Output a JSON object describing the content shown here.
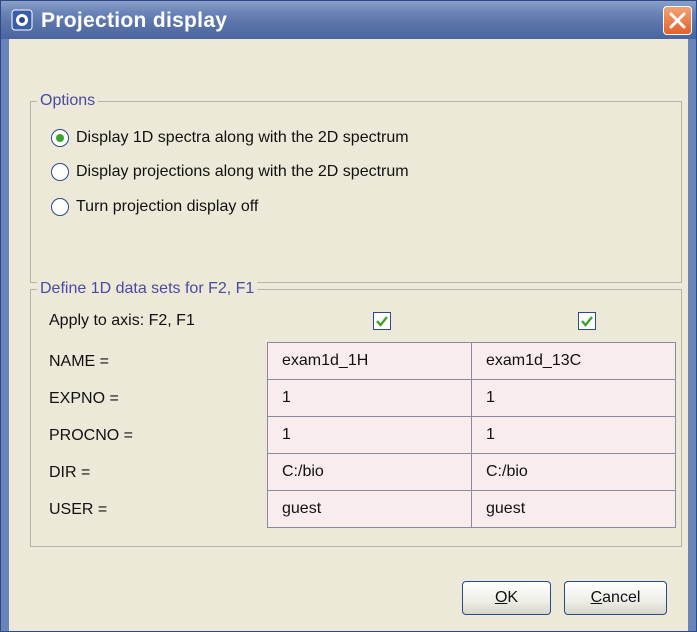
{
  "window": {
    "title": "Projection display",
    "close_icon": "close-icon"
  },
  "options": {
    "legend": "Options",
    "radios": [
      {
        "label": "Display 1D spectra along with the 2D spectrum",
        "checked": true
      },
      {
        "label": "Display projections along with the 2D spectrum",
        "checked": false
      },
      {
        "label": "Turn projection display off",
        "checked": false
      }
    ]
  },
  "datasets": {
    "legend": "Define 1D data sets for F2, F1",
    "apply_label": "Apply to axis: F2, F1",
    "apply_f2_checked": true,
    "apply_f1_checked": true,
    "rows": [
      {
        "label": "NAME =",
        "f2": "exam1d_1H",
        "f1": "exam1d_13C"
      },
      {
        "label": "EXPNO =",
        "f2": "1",
        "f1": "1"
      },
      {
        "label": "PROCNO =",
        "f2": "1",
        "f1": "1"
      },
      {
        "label": "DIR =",
        "f2": "C:/bio",
        "f1": "C:/bio"
      },
      {
        "label": "USER =",
        "f2": "guest",
        "f1": "guest"
      }
    ]
  },
  "buttons": {
    "ok_mnemonic": "O",
    "ok_rest": "K",
    "cancel_mnemonic": "C",
    "cancel_rest": "ancel"
  },
  "colors": {
    "titlebar": "#6a84b8",
    "legend_text": "#4a4aa0",
    "field_bg": "#f9ecec",
    "check_green": "#3aa52a"
  }
}
